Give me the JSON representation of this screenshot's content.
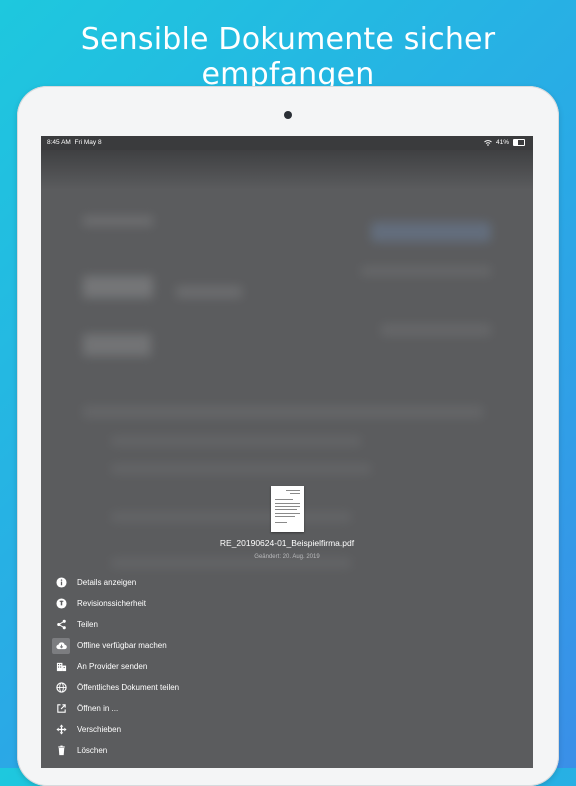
{
  "headline": "Sensible Dokumente sicher empfangen",
  "status": {
    "time": "8:45 AM",
    "date": "Fri May 8",
    "battery": "41%"
  },
  "document": {
    "filename": "RE_20190624-01_Beispielfirma.pdf",
    "modified": "Geändert: 20. Aug. 2019"
  },
  "menu": {
    "items": [
      {
        "label": "Details anzeigen",
        "icon": "info-icon"
      },
      {
        "label": "Revisionssicherheit",
        "icon": "revision-icon"
      },
      {
        "label": "Teilen",
        "icon": "share-icon"
      },
      {
        "label": "Offline verfügbar machen",
        "icon": "cloud-download-icon",
        "selected": true
      },
      {
        "label": "An Provider senden",
        "icon": "building-icon"
      },
      {
        "label": "Öffentliches Dokument teilen",
        "icon": "globe-icon"
      },
      {
        "label": "Öffnen in ...",
        "icon": "open-external-icon"
      },
      {
        "label": "Verschieben",
        "icon": "move-icon"
      },
      {
        "label": "Löschen",
        "icon": "trash-icon"
      }
    ]
  },
  "colors": {
    "background": "#2aa9e6",
    "overlay": "#5b5c5e",
    "text": "#ffffff"
  }
}
